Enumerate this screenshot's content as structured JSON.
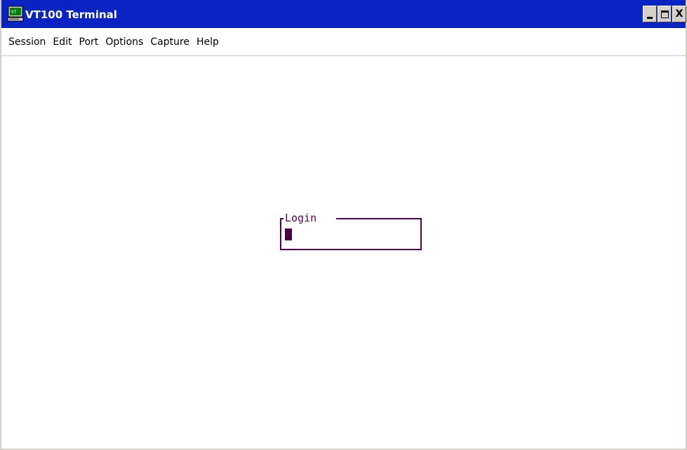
{
  "window": {
    "title": "VT100 Terminal",
    "icon": "terminal-computer-icon",
    "controls": {
      "minimize": "minimize-icon",
      "maximize": "maximize-icon",
      "close": "X"
    }
  },
  "menu": {
    "items": [
      "Session",
      "Edit",
      "Port",
      "Options",
      "Capture",
      "Help"
    ]
  },
  "terminal": {
    "login_label": "Login",
    "login_value": "",
    "colors": {
      "frame": "#5a0050",
      "cursor": "#4a0040",
      "titlebar": "#0a24c4"
    }
  }
}
